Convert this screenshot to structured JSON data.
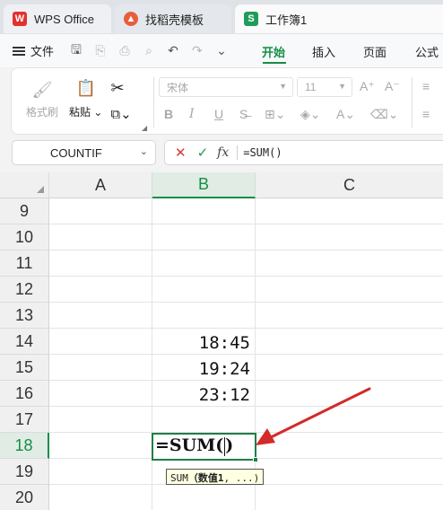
{
  "tabs": [
    {
      "label": "WPS Office",
      "icon": "wps-logo-icon"
    },
    {
      "label": "找稻壳模板",
      "icon": "docer-logo-icon"
    },
    {
      "label": "工作簿1",
      "icon": "spreadsheet-s-icon",
      "icon_letter": "S"
    }
  ],
  "menu": {
    "file_label": "文件",
    "ribbon_tabs": [
      "开始",
      "插入",
      "页面",
      "公式"
    ],
    "active_tab": "开始"
  },
  "ribbon": {
    "format_painter": "格式刷",
    "paste": "粘贴",
    "font_name": "宋体",
    "font_size": "11",
    "bold": "B",
    "italic": "I",
    "underline": "U"
  },
  "formula_bar": {
    "name_box": "COUNTIF",
    "formula": "=SUM()"
  },
  "grid": {
    "columns": [
      "A",
      "B",
      "C"
    ],
    "selected_column": "B",
    "rows": [
      "9",
      "10",
      "11",
      "12",
      "13",
      "14",
      "15",
      "16",
      "17",
      "18",
      "19",
      "20"
    ],
    "selected_row": "18",
    "b_cells": [
      {
        "row": "14",
        "value": "18:45"
      },
      {
        "row": "15",
        "value": "19:24"
      },
      {
        "row": "16",
        "value": "23:12"
      }
    ],
    "active_cell_text": "=SUM(",
    "active_cell_text_close": ")",
    "tooltip_fn": "SUM",
    "tooltip_arg": "（数值1",
    "tooltip_rest": ", ...)"
  },
  "colors": {
    "accent_green": "#148e47",
    "annotation_arrow": "#d42a2a"
  }
}
